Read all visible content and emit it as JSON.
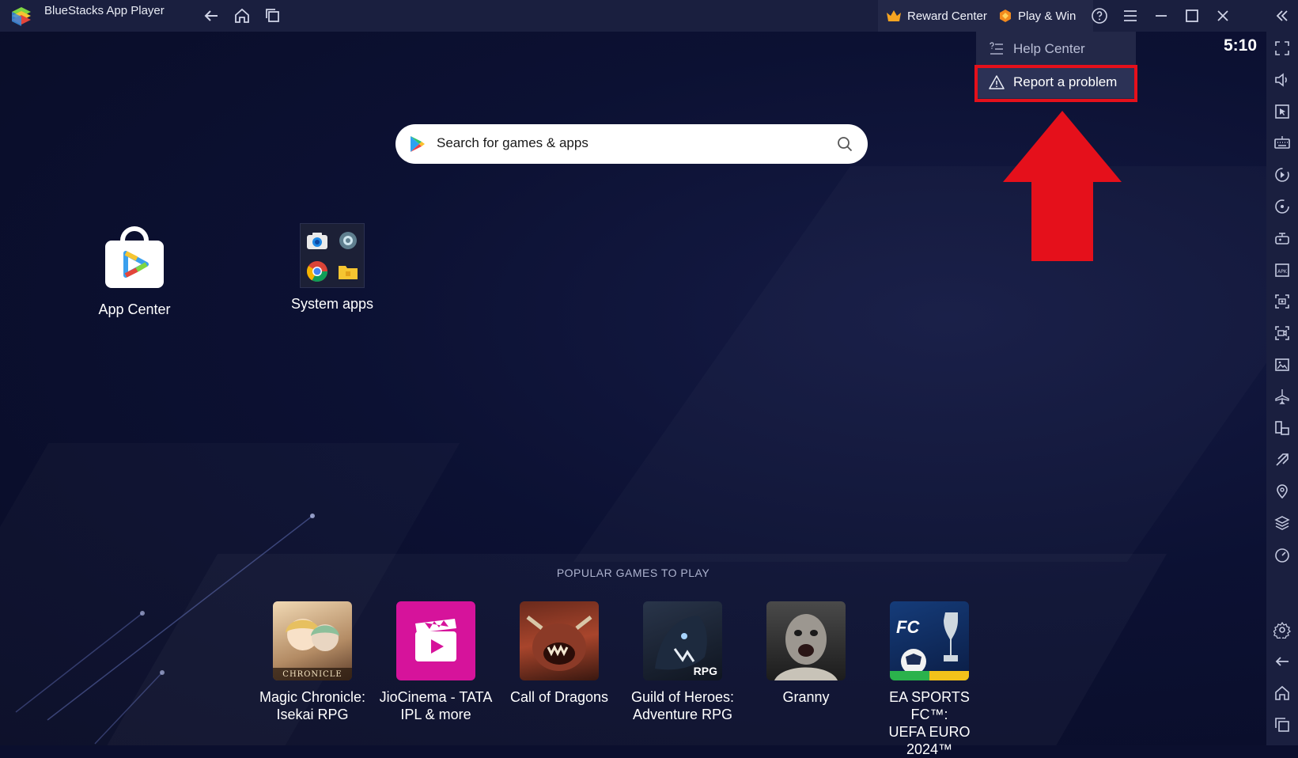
{
  "window": {
    "title": "BlueStacks App Player",
    "reward_center": "Reward Center",
    "play_win": "Play & Win"
  },
  "status": {
    "time": "5:10"
  },
  "search": {
    "placeholder": "Search for games & apps"
  },
  "desktop": {
    "app_center": "App Center",
    "system_apps": "System apps"
  },
  "menu": {
    "help_center": "Help Center",
    "report_problem": "Report a problem"
  },
  "popular": {
    "title": "POPULAR GAMES TO PLAY",
    "games": [
      {
        "line1": "Magic Chronicle:",
        "line2": "Isekai RPG",
        "badge": "CHRONICLE"
      },
      {
        "line1": "JioCinema - TATA",
        "line2": "IPL & more"
      },
      {
        "line1": "Call of Dragons",
        "line2": ""
      },
      {
        "line1": "Guild of Heroes:",
        "line2": "Adventure RPG",
        "badge": "RPG"
      },
      {
        "line1": "Granny",
        "line2": ""
      },
      {
        "line1": "EA SPORTS FC™:",
        "line2": "UEFA EURO 2024™"
      }
    ]
  },
  "colors": {
    "accent_red": "#e5101b",
    "background": "#0b0f2e",
    "titlebar": "#1a1f3f",
    "menu": "#232848"
  }
}
